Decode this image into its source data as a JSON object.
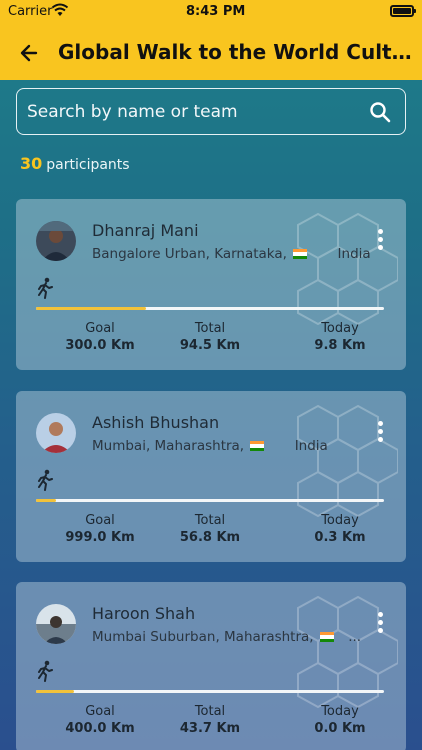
{
  "status_bar": {
    "carrier": "Carrier",
    "time": "8:43 PM"
  },
  "header": {
    "title": "Global Walk to the World Culture Festival"
  },
  "search": {
    "placeholder": "Search by name or team"
  },
  "summary": {
    "count": "30",
    "label": "participants"
  },
  "colors": {
    "accent": "#f9c51f",
    "progress": "#f2c23a"
  },
  "participants": [
    {
      "name": "Dhanraj Mani",
      "location": "Bangalore Urban, Karnataka,",
      "country": "India",
      "goal_label": "Goal",
      "goal": "300.0 Km",
      "total_label": "Total",
      "total": "94.5 Km",
      "today_label": "Today",
      "today": "9.8 Km",
      "progress_fraction": 0.315
    },
    {
      "name": "Ashish Bhushan",
      "location": "Mumbai, Maharashtra,",
      "country": "India",
      "goal_label": "Goal",
      "goal": "999.0 Km",
      "total_label": "Total",
      "total": "56.8 Km",
      "today_label": "Today",
      "today": "0.3 Km",
      "progress_fraction": 0.057
    },
    {
      "name": "Haroon Shah",
      "location": "Mumbai Suburban, Maharashtra,",
      "country": "...",
      "goal_label": "Goal",
      "goal": "400.0 Km",
      "total_label": "Total",
      "total": "43.7 Km",
      "today_label": "Today",
      "today": "0.0 Km",
      "progress_fraction": 0.109
    }
  ]
}
